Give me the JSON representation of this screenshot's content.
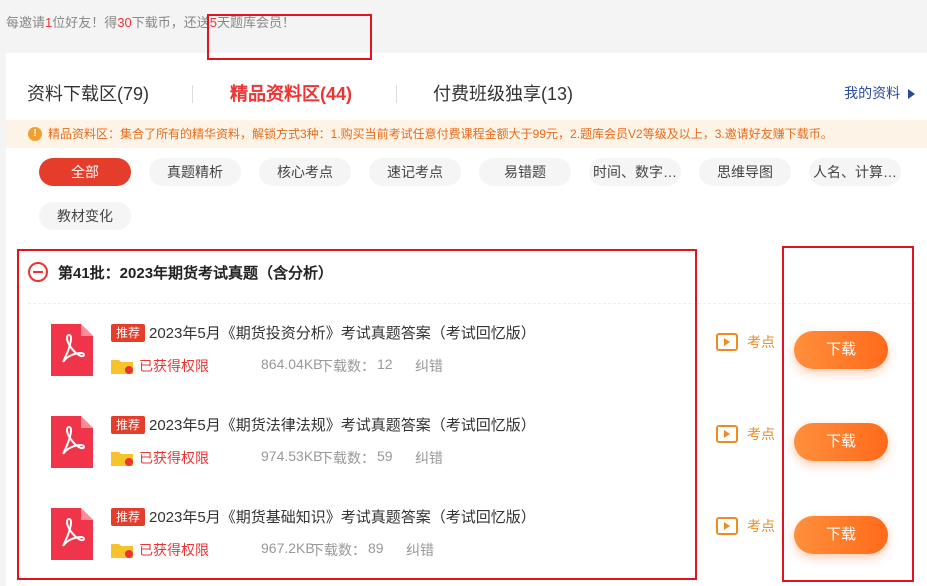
{
  "invite_banner": {
    "p1": "每邀请",
    "n1": "1",
    "p2": "位好友！得",
    "n2": "30",
    "p3": "下载币，还送",
    "n3": "5",
    "p4": "天题库会员！"
  },
  "tabs": [
    {
      "label": "资料下载区(79)"
    },
    {
      "label": "精品资料区(44)"
    },
    {
      "label": "付费班级独享(13)"
    }
  ],
  "my_resources": "我的资料",
  "notice": "精品资料区：集合了所有的精华资料，解锁方式3种：1.购买当前考试任意付费课程金额大于99元，2.题库会员V2等级及以上，3.邀请好友赚下载币。",
  "filters": [
    "全部",
    "真题精析",
    "核心考点",
    "速记考点",
    "易错题",
    "时间、数字…",
    "思维导图",
    "人名、计算…",
    "教材变化"
  ],
  "batch": {
    "title": "第41批：2023年期货考试真题（含分析）"
  },
  "labels": {
    "badge": "推荐",
    "permission": "已获得权限",
    "downloads_label": "下载数：",
    "correction": "纠错",
    "kaodian": "考点",
    "download": "下载"
  },
  "items": [
    {
      "title": "2023年5月《期货投资分析》考试真题答案（考试回忆版）",
      "size": "864.04KB",
      "downloads": "12"
    },
    {
      "title": "2023年5月《期货法律法规》考试真题答案（考试回忆版）",
      "size": "974.53KB",
      "downloads": "59"
    },
    {
      "title": "2023年5月《期货基础知识》考试真题答案（考试回忆版）",
      "size": "967.2KB",
      "downloads": "89"
    }
  ],
  "colors": {
    "accent": "#e43d2c",
    "download_button": "#ff7a2a",
    "kaodian": "#f08b24",
    "link": "#2a4a9b",
    "annotation_box": "#e0141e"
  }
}
